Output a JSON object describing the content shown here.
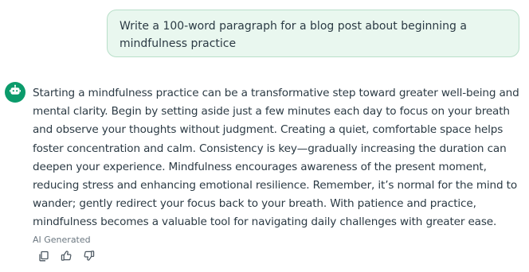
{
  "user_message": {
    "text": "Write a 100-word paragraph for a blog post about beginning a mindfulness practice"
  },
  "assistant_message": {
    "avatar_icon": "robot-icon",
    "text": "Starting a mindfulness practice can be a transformative step toward greater well-being and mental clarity. Begin by setting aside just a few minutes each day to focus on your breath and observe your thoughts without judgment. Creating a quiet, comfortable space helps foster concentration and calm. Consistency is key—gradually increasing the duration can deepen your experience. Mindfulness encourages awareness of the present moment, reducing stress and enhancing emotional resilience. Remember, it’s normal for the mind to wander; gently redirect your focus back to your breath. With patience and practice, mindfulness becomes a valuable tool for navigating daily challenges with greater ease.",
    "label": "AI Generated",
    "actions": [
      {
        "name": "copy",
        "icon": "copy-icon"
      },
      {
        "name": "thumbs-up",
        "icon": "thumbs-up-icon"
      },
      {
        "name": "thumbs-down",
        "icon": "thumbs-down-icon"
      }
    ]
  },
  "colors": {
    "user_bubble_bg": "#e9f7ef",
    "user_bubble_border": "#b8dfc9",
    "avatar_bg": "#0b9b6b",
    "text": "#2b3a44",
    "muted_text": "#6b7780"
  }
}
